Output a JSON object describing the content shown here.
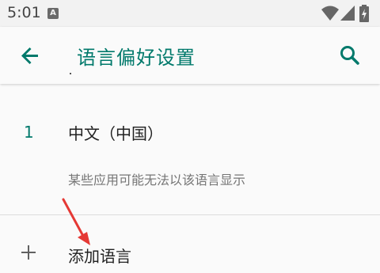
{
  "status_bar": {
    "time": "5:01",
    "notification_icon": "A"
  },
  "toolbar": {
    "title": "语言偏好设置",
    "back_icon": "arrow-back-icon",
    "search_icon": "search-icon"
  },
  "languages": [
    {
      "index": "1",
      "name": "中文（中国）",
      "warning": "某些应用可能无法以该语言显示"
    }
  ],
  "add_language": {
    "label": "添加语言",
    "icon": "plus-icon"
  },
  "colors": {
    "accent": "#00796b",
    "annotation": "#e53935"
  }
}
